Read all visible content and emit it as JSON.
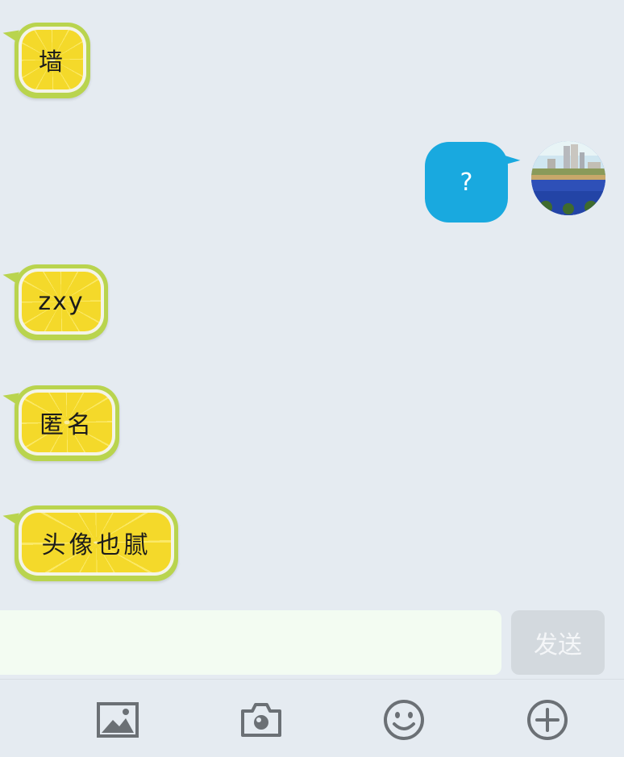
{
  "messages": [
    {
      "side": "left",
      "text": "墙"
    },
    {
      "side": "right",
      "text": "?"
    },
    {
      "side": "left",
      "text": "zxy"
    },
    {
      "side": "left",
      "text": "匿名"
    },
    {
      "side": "left",
      "text": "头像也腻"
    }
  ],
  "composer": {
    "input_value": "",
    "send_label": "发送"
  },
  "toolbar": {
    "icons": [
      "image-icon",
      "camera-icon",
      "emoji-icon",
      "plus-icon"
    ]
  },
  "colors": {
    "background": "#e5ebf1",
    "outgoing_bubble": "#19a9df",
    "lemon_yellow": "#f6dc33",
    "lemon_green": "#b9d44e",
    "input_bg": "#f3fcf2",
    "send_bg": "#d3d9de",
    "icon_gray": "#6b7075"
  }
}
